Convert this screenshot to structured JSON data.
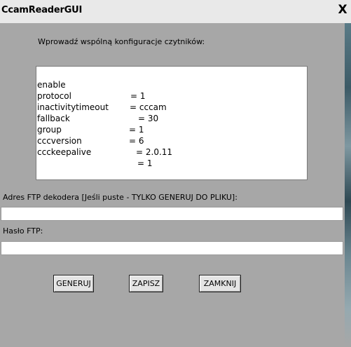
{
  "window": {
    "title": "CcamReaderGUI",
    "close_label": "X"
  },
  "config": {
    "label": "Wprowadź wspólną konfiguracje czytników:",
    "lines": [
      {
        "key": "enable",
        "value": "= 1"
      },
      {
        "key": "protocol",
        "value": "= cccam"
      },
      {
        "key": "inactivitytimeout",
        "value": "= 30"
      },
      {
        "key": "fallback",
        "value": "= 1"
      },
      {
        "key": "group",
        "value": "= 6"
      },
      {
        "key": "cccversion",
        "value": "= 2.0.11"
      },
      {
        "key": "ccckeepalive",
        "value": "= 1"
      }
    ]
  },
  "ftp": {
    "label": "Adres FTP dekodera [Jeśli puste - TYLKO GENERUJ DO PLIKU]:",
    "value": ""
  },
  "password": {
    "label": "Hasło FTP:",
    "value": ""
  },
  "buttons": {
    "generuj": "GENERUJ",
    "zapisz": "ZAPISZ",
    "zamknij": "ZAMKNIJ"
  }
}
